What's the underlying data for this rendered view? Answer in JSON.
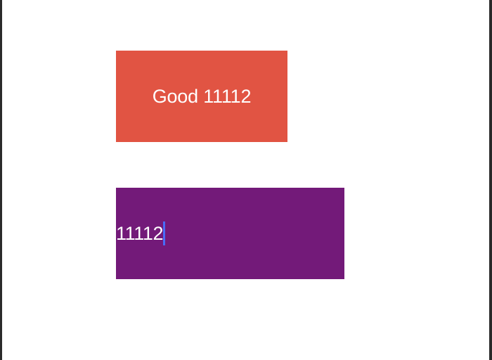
{
  "label": {
    "text": "Good 11112"
  },
  "text_field": {
    "value": "11112"
  },
  "colors": {
    "label_background": "#e15443",
    "field_background": "#731a79",
    "caret": "#4a6cf7",
    "text": "#ffffff"
  }
}
